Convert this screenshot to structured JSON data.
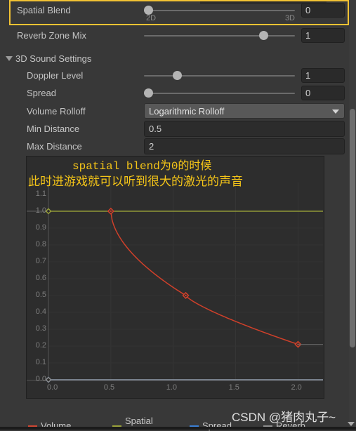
{
  "inspector": {
    "properties": [
      {
        "label": "Spatial Blend",
        "type": "slider",
        "value": "0",
        "min_label": "2D",
        "max_label": "3D",
        "knob_percent": 0,
        "highlighted": true
      },
      {
        "label": "Reverb Zone Mix",
        "type": "slider",
        "value": "1",
        "min_label": "",
        "max_label": "",
        "knob_percent": 79,
        "highlighted": false
      }
    ],
    "foldout": {
      "label": "3D Sound Settings",
      "expanded": true,
      "icon": "triangle-down-icon"
    },
    "sound3d": [
      {
        "label": "Doppler Level",
        "type": "slider",
        "value": "1",
        "knob_percent": 20
      },
      {
        "label": "Spread",
        "type": "slider",
        "value": "0",
        "knob_percent": 0
      },
      {
        "label": "Volume Rolloff",
        "type": "dropdown",
        "value": "Logarithmic Rolloff",
        "icon": "chevron-down-icon"
      },
      {
        "label": "Min Distance",
        "type": "text",
        "value": "0.5"
      },
      {
        "label": "Max Distance",
        "type": "text",
        "value": "2"
      }
    ]
  },
  "annotation": {
    "line1": "spatial blend为0的时候",
    "line2": "此时进游戏就可以听到很大的激光的声音",
    "color": "#f5c518"
  },
  "watermark": "CSDN @猪肉丸子~",
  "legend": [
    {
      "label": "Volume",
      "color": "#cf4632"
    },
    {
      "label": "Spatial",
      "color": "#9aa23a"
    },
    {
      "label": "Spread",
      "color": "#3b7fd4"
    },
    {
      "label": "Reverb",
      "color": "#8d8d8d"
    }
  ],
  "chart_data": {
    "type": "line",
    "title": "",
    "xlabel": "",
    "ylabel": "",
    "xlim": [
      0.0,
      2.2
    ],
    "ylim": [
      0.0,
      1.12
    ],
    "grid": true,
    "legend_position": "bottom",
    "x_ticks": [
      "0.0",
      "0.5",
      "1.0",
      "1.5",
      "2.0"
    ],
    "x_tick_values": [
      0.0,
      0.5,
      1.0,
      1.5,
      2.0
    ],
    "y_ticks": [
      "1.1",
      "1.0",
      "0.9",
      "0.8",
      "0.7",
      "0.6",
      "0.5",
      "0.4",
      "0.3",
      "0.2",
      "0.1",
      "0.0"
    ],
    "y_tick_values": [
      1.1,
      1.0,
      0.9,
      0.8,
      0.7,
      0.6,
      0.5,
      0.4,
      0.3,
      0.2,
      0.1,
      0.0
    ],
    "series": [
      {
        "name": "Volume",
        "color": "#d0402a",
        "keyframes": [
          {
            "x": 0.5,
            "y": 1.0
          },
          {
            "x": 1.1,
            "y": 0.5
          },
          {
            "x": 2.0,
            "y": 0.21
          }
        ],
        "curve": "logarithmic-rolloff"
      },
      {
        "name": "Spatial",
        "color": "#9aa23a",
        "keyframes": [
          {
            "x": 0.0,
            "y": 1.0
          },
          {
            "x": 2.2,
            "y": 1.0
          }
        ],
        "curve": "constant"
      },
      {
        "name": "Spread",
        "color": "#3b7fd4",
        "keyframes": [
          {
            "x": 0.0,
            "y": 0.0
          },
          {
            "x": 2.2,
            "y": 0.0
          }
        ],
        "curve": "constant"
      },
      {
        "name": "Reverb",
        "color": "#8d8d8d",
        "keyframes": [
          {
            "x": 0.0,
            "y": 0.0
          },
          {
            "x": 2.2,
            "y": 0.0
          }
        ],
        "curve": "constant"
      }
    ]
  }
}
